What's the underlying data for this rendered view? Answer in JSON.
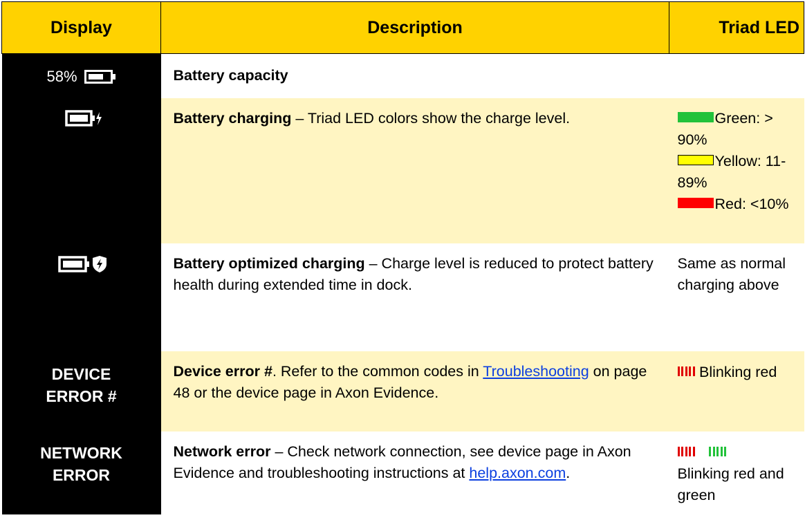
{
  "table": {
    "headers": {
      "display": "Display",
      "description": "Description",
      "led": "Triad LED"
    },
    "rows": [
      {
        "display_text": "58%",
        "icon": "battery-icon",
        "title": "Battery capacity",
        "rest": ""
      },
      {
        "icon": "battery-charging-icon",
        "title": "Battery charging",
        "rest": " – Triad LED colors show the charge level.",
        "led_items": [
          {
            "color": "#22c23a",
            "label": "Green: > 90%"
          },
          {
            "color": "#ffff00",
            "label": "Yellow: 11-89%"
          },
          {
            "color": "#ff0000",
            "label": "Red: <10%"
          }
        ]
      },
      {
        "icon": "battery-shield-icon",
        "title": "Battery optimized charging",
        "rest": " – Charge level is reduced to protect battery health during extended time in dock.",
        "led": "Same as normal charging above"
      },
      {
        "display_text": "DEVICE ERROR #",
        "title": "Device error #",
        "rest_1": ". Refer to the common codes in ",
        "link": "Troubleshooting",
        "rest_2": " on page 48 or the device page in Axon Evidence.",
        "led": "Blinking red",
        "blink_colors": [
          "#e00000"
        ]
      },
      {
        "display_text": "NETWORK ERROR",
        "title": "Network error",
        "rest_1": " – Check network connection, see device page in Axon Evidence and troubleshooting instructions at ",
        "link": "help.axon.com",
        "rest_2": ".",
        "led": "Blinking red and green",
        "blink_colors": [
          "#e00000",
          "#22c23a"
        ]
      }
    ]
  }
}
